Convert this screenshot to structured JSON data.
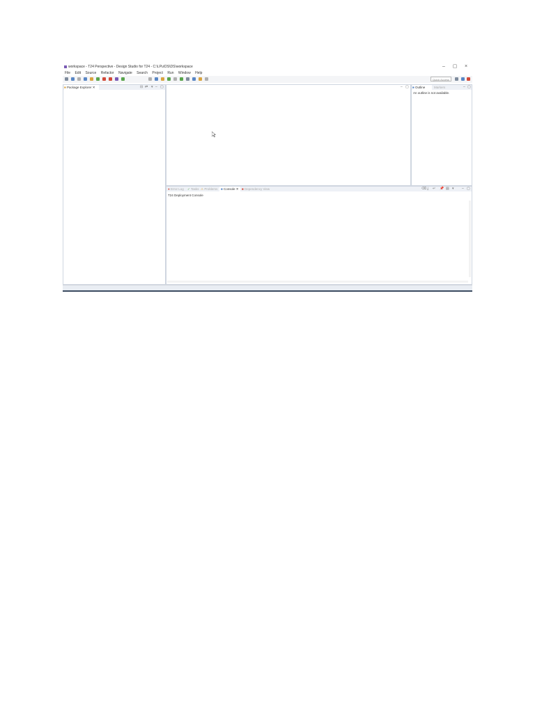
{
  "window": {
    "title": "workspace - T24 Perspective - Design Studio for T24 - C:\\LPu\\DS\\DS\\workspace",
    "controls": {
      "minimize": "–",
      "maximize": "▢",
      "close": "×"
    }
  },
  "menu": [
    "File",
    "Edit",
    "Source",
    "Refactor",
    "Navigate",
    "Search",
    "Project",
    "Run",
    "Window",
    "Help"
  ],
  "toolbar": {
    "quick_access": "Quick Access",
    "icon_colors": [
      "#7f8c9d",
      "#5a87c5",
      "#b0b0b0",
      "#5a87c5",
      "#d9a441",
      "#5aa54d",
      "#d24a3a",
      "#d24a3a",
      "#7a5ab5",
      "#5aa54d",
      "#b0b0b0",
      "#5a87c5",
      "#d9a441",
      "#5aa54d",
      "#b0b0b0",
      "#5aa54d",
      "#7f8c9d",
      "#5a87c5",
      "#d9a441",
      "#b0b0b0"
    ]
  },
  "left_pane": {
    "tab": "Package Explorer",
    "close": "✕"
  },
  "outline_pane": {
    "tab_outline": "Outline",
    "tab_second": "Markers",
    "message": "An outline is not available."
  },
  "console_pane": {
    "tabs": [
      "Error Log",
      "Tasks",
      "Problems",
      "Console",
      "Dependency View"
    ],
    "active_tab": "Console",
    "console_name": "T24 Deployment Console"
  },
  "pane_controls": {
    "minimize": "–",
    "maximize": "▢"
  },
  "colors": {
    "accent": "#5a87c5",
    "pane_border": "#cfd6e0",
    "header_bg": "#eef1f6"
  }
}
